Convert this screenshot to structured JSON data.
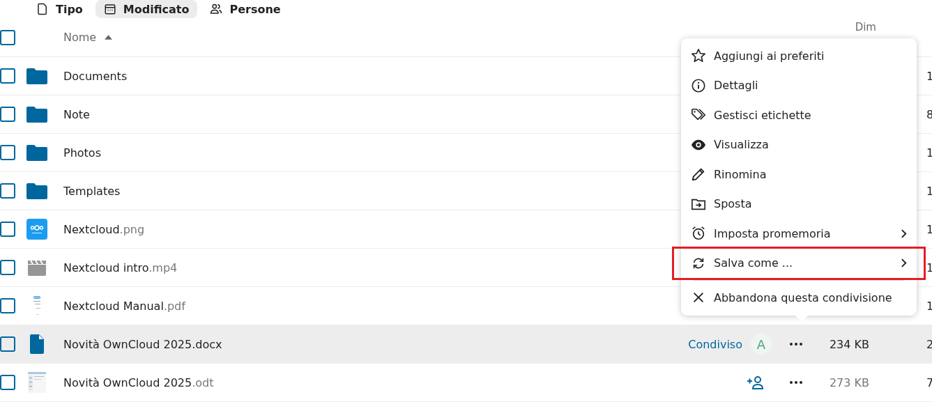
{
  "filters": [
    {
      "label": "Tipo",
      "selected": false
    },
    {
      "label": "Modificato",
      "selected": true
    },
    {
      "label": "Persone",
      "selected": false
    }
  ],
  "table": {
    "select_all_checked": false,
    "name_header": "Nome",
    "size_header": "Dim",
    "rows": [
      {
        "kind": "folder",
        "name": "Documents",
        "checked": false,
        "highlighted": false,
        "column_6": "1"
      },
      {
        "kind": "folder",
        "name": "Note",
        "checked": false,
        "highlighted": false,
        "column_6": "8"
      },
      {
        "kind": "folder",
        "name": "Photos",
        "checked": false,
        "highlighted": false,
        "column_6": "1"
      },
      {
        "kind": "folder",
        "name": "Templates",
        "checked": false,
        "highlighted": false,
        "column_6": "1"
      },
      {
        "kind": "image",
        "name": "Nextcloud",
        "ext": ".png",
        "checked": false,
        "highlighted": false,
        "column_6": "1"
      },
      {
        "kind": "video",
        "name": "Nextcloud intro",
        "ext": ".mp4",
        "checked": false,
        "highlighted": false,
        "column_6": "1"
      },
      {
        "kind": "pdf",
        "name": "Nextcloud Manual",
        "ext": ".pdf",
        "checked": false,
        "highlighted": false,
        "column_6": "1"
      },
      {
        "kind": "document",
        "name": "Novità OwnCloud 2025",
        "ext": ".docx",
        "checked": false,
        "highlighted": true,
        "share_label": "Condiviso",
        "avatar": "A",
        "actions": true,
        "size": "234 KB",
        "column_6": "2"
      },
      {
        "kind": "text",
        "name": "Novità OwnCloud 2025",
        "ext": ".odt",
        "checked": false,
        "highlighted": false,
        "add_share": true,
        "actions": true,
        "size": "273 KB",
        "column_6": "7"
      }
    ]
  },
  "menu": {
    "items": [
      {
        "kind": "favorite",
        "label": "Aggiungi ai preferiti",
        "submenu": false,
        "annotated": false,
        "divider_before": false
      },
      {
        "kind": "details",
        "label": "Dettagli",
        "submenu": false,
        "annotated": false,
        "divider_before": false
      },
      {
        "kind": "tags",
        "label": "Gestisci etichette",
        "submenu": false,
        "annotated": false,
        "divider_before": false
      },
      {
        "kind": "view",
        "label": "Visualizza",
        "submenu": false,
        "annotated": false,
        "divider_before": false
      },
      {
        "kind": "rename",
        "label": "Rinomina",
        "submenu": false,
        "annotated": false,
        "divider_before": false
      },
      {
        "kind": "move",
        "label": "Sposta",
        "submenu": false,
        "annotated": false,
        "divider_before": false
      },
      {
        "kind": "reminder",
        "label": "Imposta promemoria",
        "submenu": true,
        "annotated": false,
        "divider_before": false
      },
      {
        "kind": "convert",
        "label": "Salva come ...",
        "submenu": true,
        "annotated": true,
        "divider_before": false
      },
      {
        "kind": "leave",
        "label": "Abbandona questa condivisione",
        "submenu": false,
        "annotated": false,
        "divider_before": true
      }
    ]
  }
}
